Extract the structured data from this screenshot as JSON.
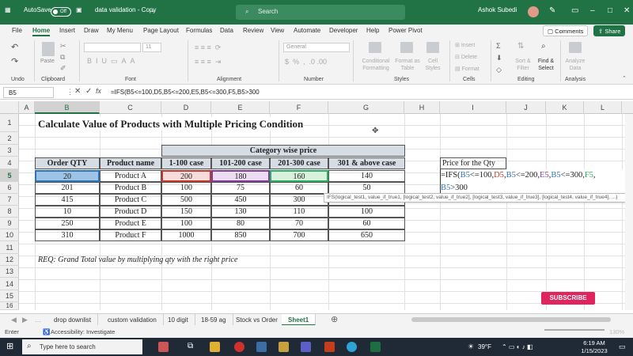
{
  "titlebar": {
    "autosave_label": "AutoSave",
    "autosave_state": "Off",
    "file_name": "data validation - Copy",
    "search_placeholder": "Search",
    "user_name": "Ashok Subedi"
  },
  "menu": [
    "File",
    "Home",
    "Insert",
    "Draw",
    "My Menu",
    "Page Layout",
    "Formulas",
    "Data",
    "Review",
    "View",
    "Automate",
    "Developer",
    "Help",
    "Power Pivot"
  ],
  "menu_right": {
    "comments": "Comments",
    "share": "Share"
  },
  "ribbon": {
    "groups": [
      "Undo",
      "Clipboard",
      "Font",
      "Alignment",
      "Number",
      "Styles",
      "Cells",
      "Editing",
      "Analysis"
    ],
    "paste": "Paste",
    "font_size": "11",
    "number_format": "General",
    "conditional_formatting": "Conditional Formatting",
    "format_as_table": "Format as Table",
    "cell_styles": "Cell Styles",
    "insert": "Insert",
    "delete": "Delete",
    "format": "Format",
    "sort_filter": "Sort & Filter",
    "find_select": "Find & Select",
    "analyze_data": "Analyze Data"
  },
  "formula_bar": {
    "name_box": "B5",
    "formula": "=IFS(B5<=100,D5,B5<=200,E5,B5<=300,F5,B5>300"
  },
  "columns": [
    "A",
    "B",
    "C",
    "D",
    "E",
    "F",
    "G",
    "H",
    "I",
    "J",
    "K",
    "L"
  ],
  "rows": [
    "1",
    "2",
    "3",
    "4",
    "5",
    "6",
    "7",
    "8",
    "9",
    "10",
    "11",
    "12",
    "13",
    "14",
    "15",
    "16"
  ],
  "sheet": {
    "title": "Calculate Value of Products with Multiple Pricing Condition",
    "category_header": "Category wise price",
    "headers": [
      "Order QTY",
      "Product name",
      "1-100 case",
      "101-200 case",
      "201-300 case",
      "301 & above case"
    ],
    "table": [
      [
        "20",
        "Product A",
        "200",
        "180",
        "160",
        "140"
      ],
      [
        "201",
        "Product B",
        "100",
        "75",
        "60",
        "50"
      ],
      [
        "415",
        "Product C",
        "500",
        "450",
        "300",
        ""
      ],
      [
        "10",
        "Product D",
        "150",
        "130",
        "110",
        "100"
      ],
      [
        "250",
        "Product E",
        "100",
        "80",
        "70",
        "60"
      ],
      [
        "310",
        "Product F",
        "1000",
        "850",
        "700",
        "650"
      ]
    ],
    "note": "REQ: Grand Total value by multiplying qty with the right price",
    "price_label": "Price for the Qty",
    "edit_line1": [
      "=IFS(",
      "B5",
      "<=100,",
      "D5",
      ",",
      "B5",
      "<=200,",
      "E5",
      ",",
      "B5",
      "<=300,",
      "F5",
      ","
    ],
    "edit_line2": [
      "B5",
      ">300"
    ],
    "tooltip": "IFS(logical_test1, value_if_true1, [logical_test2, value_if_true2], [logical_test3, value_if_true3], [logical_test4, value_if_true4], ...)"
  },
  "sheet_tabs": [
    "drop downlist",
    "custom validation",
    "10 digit",
    "18-59 ag",
    "Stock vs Order",
    "Sheet1"
  ],
  "active_tab": "Sheet1",
  "status": {
    "mode": "Enter",
    "accessibility": "Accessibility: Investigate",
    "zoom": "130%"
  },
  "taskbar": {
    "search": "Type here to search",
    "weather": "39°F",
    "time": "6:19 AM",
    "date": "1/15/2023"
  },
  "overlay": {
    "subscribe": "SUBSCRIBE"
  },
  "colors": {
    "excel_green": "#217346",
    "header_fill": "#d6dce4",
    "sel_blue": "#9dc3e6",
    "ref_red": "#c0392b",
    "ref_purple": "#7d3c98",
    "ref_green": "#27ae60",
    "ref_blue": "#2e75b6"
  }
}
